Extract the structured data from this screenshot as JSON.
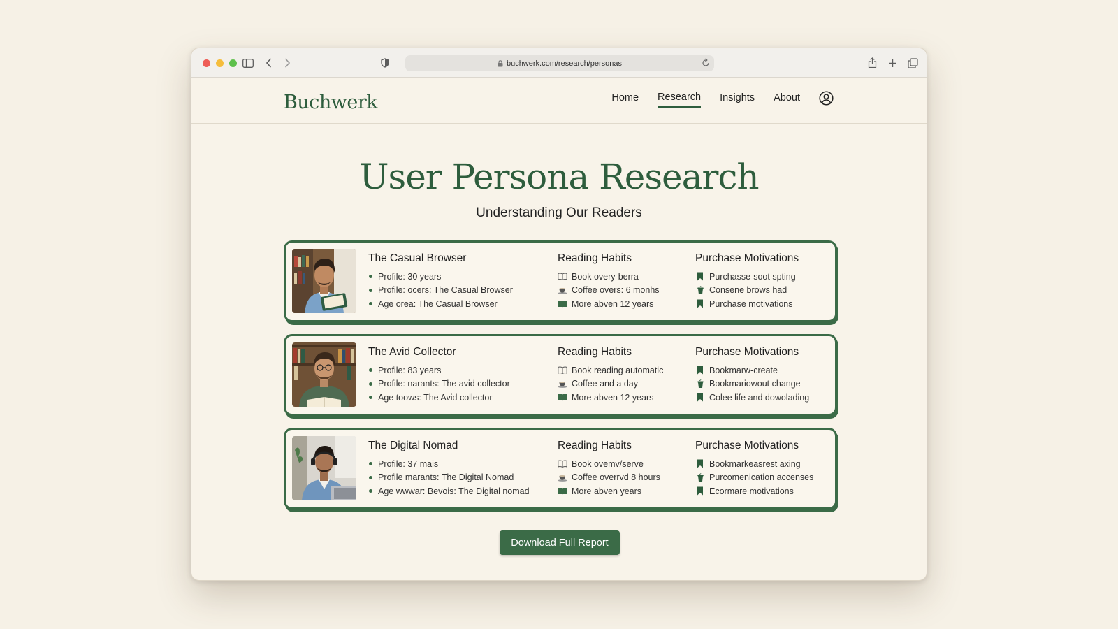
{
  "browser": {
    "url": "buchwerk.com/research/personas"
  },
  "site": {
    "logo": "Buchwerk",
    "nav": [
      "Home",
      "Research",
      "Insights",
      "About"
    ],
    "active_nav": "Research"
  },
  "hero": {
    "title": "User Persona Research",
    "subtitle": "Understanding Our Readers"
  },
  "section_labels": {
    "habits": "Reading Habits",
    "motivations": "Purchase Motivations"
  },
  "personas": [
    {
      "name": "The Casual Browser",
      "profile": [
        "Profile: 30 years",
        "Profile: ocers: The Casual Browser",
        "Age orea: The Casual Browser"
      ],
      "habits": [
        "Book overy-berra",
        "Coffee overs: 6 monhs",
        "More abven 12 years"
      ],
      "motivations": [
        "Purchasse-soot spting",
        "Consene brows had",
        "Purchase motivations"
      ]
    },
    {
      "name": "The Avid Collector",
      "profile": [
        "Profile: 83 years",
        "Profile: narants: The avid collector",
        "Age toows: The Avid collector"
      ],
      "habits": [
        "Book reading automatic",
        "Coffee and a day",
        "More abven 12 years"
      ],
      "motivations": [
        "Bookmarw-create",
        "Bookmariowout change",
        "Colee life and dowolading"
      ]
    },
    {
      "name": "The Digital Nomad",
      "profile": [
        "Profile: 37 mais",
        "Profile marants: The Digital Nomad",
        "Age wwwar: Bevois: The Digital nomad"
      ],
      "habits": [
        "Book ovemv/serve",
        "Coffee overrvd 8 hours",
        "More abven years"
      ],
      "motivations": [
        "Bookmarkeasrest axing",
        "Purcomenication accenses",
        "Ecormare motivations"
      ]
    }
  ],
  "cta": {
    "label": "Download Full Report"
  },
  "colors": {
    "brand_green": "#2e5d3d",
    "card_border": "#3b6b47",
    "page_bg": "#f6f1e6"
  },
  "icons": [
    "sidebar-icon",
    "back-icon",
    "forward-icon",
    "shield-icon",
    "lock-icon",
    "reload-icon",
    "share-icon",
    "new-tab-icon",
    "tabs-icon",
    "account-icon",
    "open-book-icon",
    "coffee-cup-icon",
    "closed-book-icon",
    "bookmark-icon",
    "latte-icon"
  ]
}
